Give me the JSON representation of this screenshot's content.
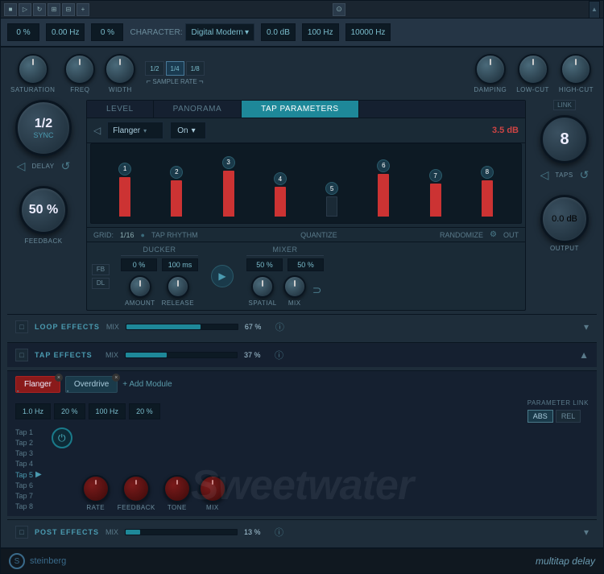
{
  "topbar": {
    "icons": [
      "■",
      "▷",
      "↻",
      "||",
      "⊞",
      "⊟",
      "+",
      "-"
    ],
    "camera": "⊙"
  },
  "header": {
    "saturation_val": "0 %",
    "freq_val": "0.00 Hz",
    "width_val": "0 %",
    "character_label": "CHARACTER:",
    "character_value": "Digital Modern",
    "damping_val": "0.0 dB",
    "lowcut_val": "100 Hz",
    "highcut_val": "10000 Hz"
  },
  "knobs": {
    "saturation_label": "SATURATION",
    "freq_label": "FREQ",
    "width_label": "WIDTH",
    "sample_rate_label": "SAMPLE RATE",
    "sr_buttons": [
      "1/2",
      "1/4",
      "1/8"
    ],
    "damping_label": "DAMPING",
    "lowcut_label": "LOW-CUT",
    "highcut_label": "HIGH-CUT"
  },
  "delay": {
    "display": "1/2",
    "sync": "SYNC",
    "label": "DELAY",
    "feedback_display": "50 %",
    "feedback_label": "FEEDBACK"
  },
  "tabs": {
    "items": [
      "LEVEL",
      "PANORAMA",
      "TAP PARAMETERS"
    ],
    "active": 2
  },
  "sequencer": {
    "flanger_label": "Flanger",
    "on_label": "On",
    "db_value": "3.5 dB",
    "bars": [
      {
        "num": "1",
        "height": 60,
        "active": true
      },
      {
        "num": "2",
        "height": 55,
        "active": true
      },
      {
        "num": "3",
        "height": 70,
        "active": true
      },
      {
        "num": "4",
        "height": 45,
        "active": true
      },
      {
        "num": "5",
        "height": 30,
        "active": false
      },
      {
        "num": "6",
        "height": 65,
        "active": true
      },
      {
        "num": "7",
        "height": 50,
        "active": true
      },
      {
        "num": "8",
        "height": 55,
        "active": true
      }
    ],
    "grid_label": "GRID:",
    "grid_value": "1/16",
    "tap_rhythm": "TAP RHYTHM",
    "quantize": "QUANTIZE",
    "randomize": "RANDOMIZE",
    "out": "OUT"
  },
  "ducker": {
    "label": "DUCKER",
    "amount_val": "0 %",
    "release_val": "100 ms",
    "amount_label": "AMOUNT",
    "release_label": "RELEASE",
    "fb": "FB",
    "dl": "DL"
  },
  "mixer": {
    "label": "MIXER",
    "spatial_val": "50 %",
    "mix_val": "50 %",
    "spatial_label": "SPATIAL",
    "mix_label": "MIX"
  },
  "taps": {
    "display": "8",
    "label": "TAPS",
    "link": "LINK"
  },
  "output": {
    "value": "0.0 dB",
    "label": "OUTPUT"
  },
  "loop_effects": {
    "label": "LOOP EFFECTS",
    "mix_label": "MIX",
    "mix_pct": "67 %",
    "fill_width": "67"
  },
  "tap_effects": {
    "label": "TAP EFFECTS",
    "mix_label": "MIX",
    "mix_pct": "37 %",
    "fill_width": "37"
  },
  "post_effects": {
    "label": "POST EFFECTS",
    "mix_label": "MIX",
    "mix_pct": "13 %",
    "fill_width": "13"
  },
  "modules": {
    "flanger": "Flanger",
    "overdrive": "Overdrive",
    "add": "+ Add Module"
  },
  "tap_params": {
    "param1": "1.0 Hz",
    "param2": "20 %",
    "param3": "100 Hz",
    "param4": "20 %",
    "rate_label": "RATE",
    "feedback_label": "FEEDBACK",
    "tone_label": "TONE",
    "mix_label": "MIX"
  },
  "tap_list": {
    "items": [
      "Tap 1",
      "Tap 2",
      "Tap 3",
      "Tap 4",
      "Tap 5",
      "Tap 6",
      "Tap 7",
      "Tap 8"
    ],
    "active_index": 4
  },
  "param_link": {
    "label": "PARAMETER LINK",
    "abs": "ABS",
    "rel": "REL"
  },
  "bottom": {
    "brand": "steinberg",
    "product": "multitap delay"
  },
  "watermark": "Sweetwater"
}
